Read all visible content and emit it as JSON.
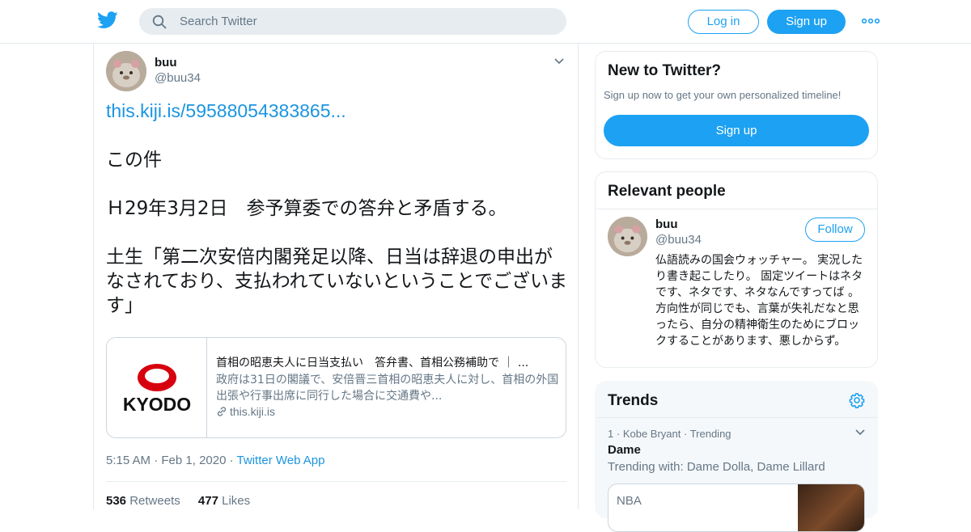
{
  "header": {
    "search_placeholder": "Search Twitter",
    "login_label": "Log in",
    "signup_label": "Sign up",
    "brand_color": "#1da1f2"
  },
  "tweet": {
    "name": "buu",
    "handle": "@buu34",
    "link": "this.kiji.is/59588054383865...",
    "line1": "この件",
    "line2": "Ｈ29年3月2日　参予算委での答弁と矛盾する。",
    "line3": "土生「第二次安倍内閣発足以降、日当は辞退の申出がなされており、支払われていないということでございます」",
    "card": {
      "image_label": "KYODO",
      "title": "首相の昭恵夫人に日当支払い　答弁書、首相公務補助で ｜ ...",
      "description": "政府は31日の閣議で、安倍晋三首相の昭恵夫人に対し、首相の外国出張や行事出席に同行した場合に交通費や...",
      "domain": "this.kiji.is"
    },
    "time": "5:15 AM",
    "date": "Feb 1, 2020",
    "source": "Twitter Web App",
    "retweets_count": "536",
    "retweets_label": "Retweets",
    "likes_count": "477",
    "likes_label": "Likes"
  },
  "sidebar": {
    "new_title": "New to Twitter?",
    "new_sub": "Sign up now to get your own personalized timeline!",
    "new_signup": "Sign up",
    "relevant_title": "Relevant people",
    "person": {
      "name": "buu",
      "handle": "@buu34",
      "follow_label": "Follow",
      "bio": "仏語読みの国会ウォッチャー。 実況したり書き起こしたり。 固定ツイートはネタです、ネタです、ネタなんですってば 。 方向性が同じでも、言葉が失礼だなと思ったら、自分の精神衛生のためにブロックすることがあります、悪しからず。"
    },
    "trends_title": "Trends",
    "trend": {
      "rank": "1",
      "context": "Kobe Bryant",
      "status": "Trending",
      "name": "Dame",
      "with": "Trending with: Dame Dolla, Dame Lillard",
      "card_label": "NBA"
    }
  }
}
